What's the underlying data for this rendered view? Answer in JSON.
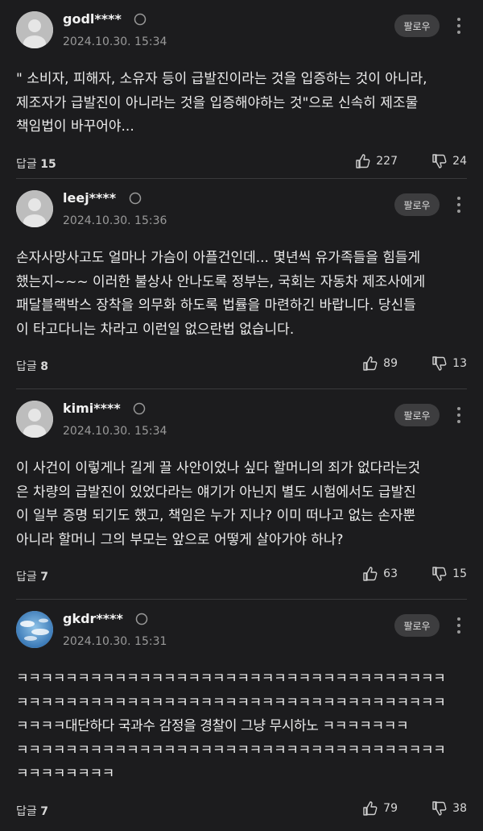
{
  "comments": [
    {
      "username": "godl****",
      "timestamp": "2024.10.30. 15:34",
      "follow_label": "팔로우",
      "text": "\" 소비자, 피해자, 소유자 등이 급발진이라는 것을 입증하는 것이 아니라,\n제조자가 급발진이 아니라는 것을 입증해야하는 것\"으로 신속히 제조물\n책임법이 바꾸어야...",
      "reply_label": "답글",
      "reply_count": "15",
      "likes": "227",
      "dislikes": "24",
      "avatar": "default-avatar"
    },
    {
      "username": "leej****",
      "timestamp": "2024.10.30. 15:36",
      "follow_label": "팔로우",
      "text": "손자사망사고도 얼마나 가슴이 아플건인데... 몇년씩 유가족들을 힘들게\n했는지~~~ 이러한 불상사 안나도록 정부는, 국회는 자동차 제조사에게\n패달블랙박스 장착을 의무화 하도록 법률을 마련하긴 바랍니다. 당신들\n이 타고다니는 차라고 이런일 없으란법 없습니다.",
      "reply_label": "답글",
      "reply_count": "8",
      "likes": "89",
      "dislikes": "13",
      "avatar": "default-avatar"
    },
    {
      "username": "kimi****",
      "timestamp": "2024.10.30. 15:34",
      "follow_label": "팔로우",
      "text": "이 사건이 이렇게나 길게 끌 사안이었나 싶다 할머니의 죄가 없다라는것\n은 차량의 급발진이 있었다라는 얘기가 아닌지 별도 시험에서도 급발진\n이 일부 증명 되기도 했고, 책임은 누가 지나? 이미 떠나고 없는 손자뿐\n아니라 할머니 그의 부모는 앞으로 어떻게 살아가야 하나?",
      "reply_label": "답글",
      "reply_count": "7",
      "likes": "63",
      "dislikes": "15",
      "avatar": "default-avatar"
    },
    {
      "username": "gkdr****",
      "timestamp": "2024.10.30. 15:31",
      "follow_label": "팔로우",
      "text": "ㅋㅋㅋㅋㅋㅋㅋㅋㅋㅋㅋㅋㅋㅋㅋㅋㅋㅋㅋㅋㅋㅋㅋㅋㅋㅋㅋㅋㅋㅋㅋㅋㅋㅋㅋ\nㅋㅋㅋㅋㅋㅋㅋㅋㅋㅋㅋㅋㅋㅋㅋㅋㅋㅋㅋㅋㅋㅋㅋㅋㅋㅋㅋㅋㅋㅋㅋㅋㅋㅋㅋ\nㅋㅋㅋㅋ대단하다 국과수 감정을 경찰이 그냥 무시하노 ㅋㅋㅋㅋㅋㅋㅋ\nㅋㅋㅋㅋㅋㅋㅋㅋㅋㅋㅋㅋㅋㅋㅋㅋㅋㅋㅋㅋㅋㅋㅋㅋㅋㅋㅋㅋㅋㅋㅋㅋㅋㅋㅋ\nㅋㅋㅋㅋㅋㅋㅋㅋ",
      "reply_label": "답글",
      "reply_count": "7",
      "likes": "79",
      "dislikes": "38",
      "avatar": "sky-avatar"
    }
  ],
  "colors": {
    "background": "#1c1c1e",
    "divider": "#3a3a3c",
    "follow_button": "#3d3d3f"
  },
  "icons": {
    "badge": "circle-outline-icon",
    "more": "more-vertical-icon",
    "like": "thumbs-up-icon",
    "dislike": "thumbs-down-icon"
  }
}
